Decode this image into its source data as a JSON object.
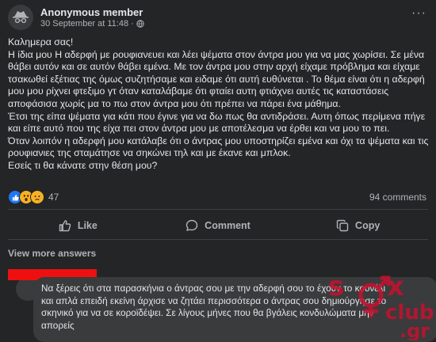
{
  "post": {
    "author": "Anonymous member",
    "date": "30 September at 11:48",
    "dot": "·",
    "more_label": "···",
    "paragraphs": [
      "Καλημερα σας!",
      "Η ίδια μου Η αδερφή με ρουφιανευει και λέει ψέματα στον άντρα μου για να μας χωρίσει. Σε μένα θάβει αυτόν και σε αυτόν θάβει εμένα.  Με τον άντρα μου στην αρχή είχαμε πρόβλημα και είχαμε τσακωθεί εξέτιας της όμως συζητήσαμε και ειδαμε ότι αυτή ευθύνεται . Το θέμα είναι ότι η αδερφή μου μου ρίχνει φτεξιμο γτ όταν καταλάβαμε ότι φταίει αυτη φτιάχνει αυτές τις καταστάσεις αποφάσισα χωρίς μα το πω στον άντρα μου ότι πρέπει να πάρει ένα μάθημα.",
      "Έτσι της είπα ψέματα για κάτι που έγινε για να δω πως θα αντιδράσει.  Αυτη όπως περίμενα πήγε και είπε αυτό που της είχα πει στον άντρα μου με αποτέλεσμα να έρθει και να μου το πει.",
      "Όταν λοιπόν η αδερφή μου κατάλαβε ότι ο άντρας μου υποστηρίζει εμένα και όχι τα ψέματα και τις ρουφιανιες της σταμάτησε να σηκώνει τηλ και με έκανε και μπλοκ.",
      "Εσείς τι θα κάνατε στην θέση μου?"
    ]
  },
  "reactions": {
    "count": "47",
    "comments": "94 comments",
    "icons": [
      "like-icon",
      "wow-icon",
      "sad-icon"
    ]
  },
  "actions": {
    "like": "Like",
    "comment": "Comment",
    "copy": "Copy"
  },
  "view_more": "View more answers",
  "comment": {
    "text": "Να ξέρεις ότι στα παρασκήνια ο άντρας σου με την αδερφή σου το έχουν το κουνέλι και απλά επειδή εκείνη άρχισε να ζητάει περισσότερα ο άντρας σου δημιούργησε το σκηνικό για να σε κοροϊδέψει. Σε λίγους μήνες που θα βγάλεις κονδυλώματα μην απορείς"
  },
  "watermark": {
    "brand_top": "sex",
    "brand_mid": "club",
    "brand_tld": ".gr",
    "color": "#c8102e"
  },
  "colors": {
    "background": "#242526",
    "text": "#e4e6eb",
    "secondary_text": "#b0b3b8",
    "like_blue": "#2078f4",
    "redaction": "#ee1010"
  }
}
